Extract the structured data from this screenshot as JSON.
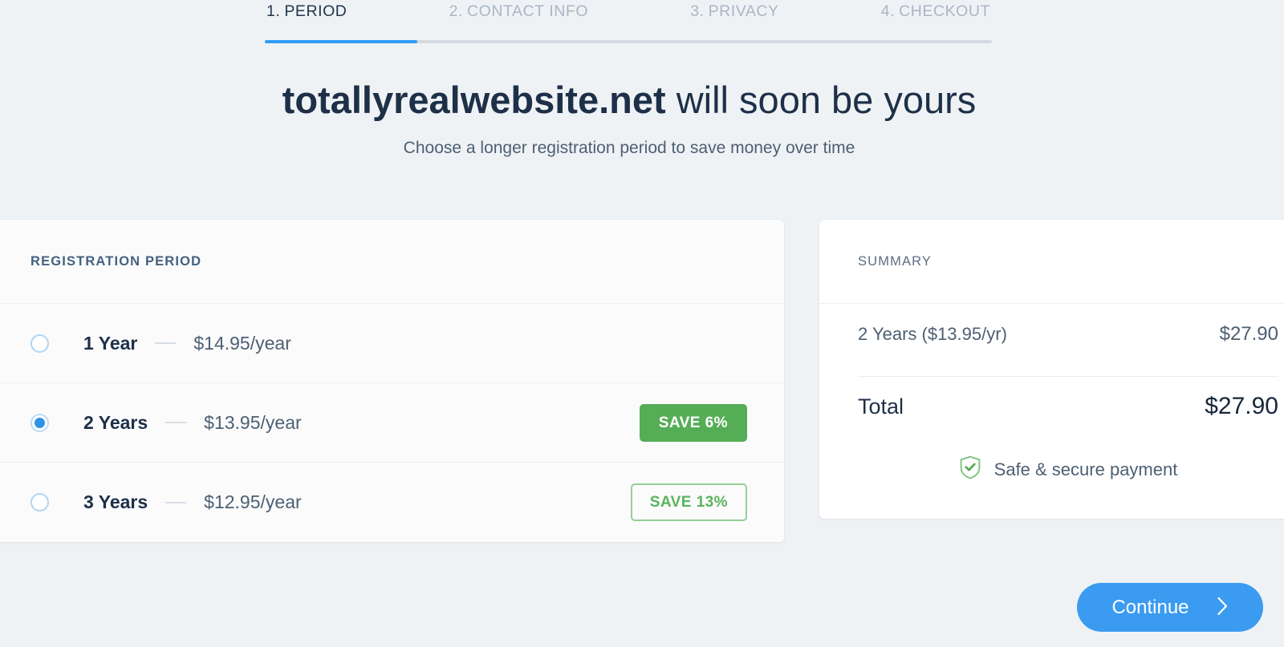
{
  "steps": {
    "items": [
      {
        "num": "1.",
        "label": "PERIOD",
        "active": true
      },
      {
        "num": "2.",
        "label": "CONTACT INFO",
        "active": false
      },
      {
        "num": "3.",
        "label": "PRIVACY",
        "active": false
      },
      {
        "num": "4.",
        "label": "CHECKOUT",
        "active": false
      }
    ],
    "progress_percent": 21,
    "active_color": "#2f9cf4",
    "track_color": "#d3dae0"
  },
  "header": {
    "domain": "totallyrealwebsite.net",
    "headline_rest": " will soon be yours",
    "subtitle": "Choose a longer registration period to save money over time"
  },
  "period_card": {
    "title": "REGISTRATION PERIOD",
    "options": [
      {
        "label": "1 Year",
        "price": "$14.95/year",
        "selected": false,
        "badge": null,
        "badge_style": null
      },
      {
        "label": "2 Years",
        "price": "$13.95/year",
        "selected": true,
        "badge": "SAVE 6%",
        "badge_style": "solid"
      },
      {
        "label": "3 Years",
        "price": "$12.95/year",
        "selected": false,
        "badge": "SAVE 13%",
        "badge_style": "outline"
      }
    ]
  },
  "summary": {
    "title": "SUMMARY",
    "line_item_label": "2 Years ($13.95/yr)",
    "line_item_value": "$27.90",
    "total_label": "Total",
    "total_value": "$27.90",
    "secure_text": "Safe & secure payment",
    "secure_icon": "shield-check-icon",
    "secure_color": "#5cb85c"
  },
  "footer": {
    "continue_label": "Continue",
    "continue_icon": "chevron-right-icon",
    "continue_color": "#3b9bf0"
  },
  "colors": {
    "page_background": "#eff2f5",
    "card_background": "#fbfbfc",
    "summary_background": "#ffffff",
    "accent_blue": "#2f93e8",
    "green_solid": "#55ad56",
    "green_outline": "#96ce97",
    "text_dark": "#1d3048",
    "text_muted": "#4c5f73",
    "text_inactive": "#a9b6c4"
  }
}
